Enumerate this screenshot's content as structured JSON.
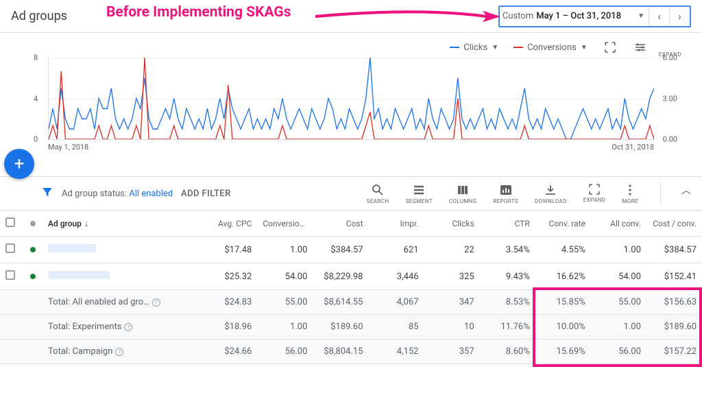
{
  "annotation": {
    "title": "Before Implementing SKAGs"
  },
  "header": {
    "title": "Ad groups",
    "date_picker": {
      "custom_label": "Custom",
      "range": "May 1 – Oct 31, 2018"
    }
  },
  "metrics": {
    "primary": {
      "label": "Clicks",
      "color": "#1a73e8"
    },
    "secondary": {
      "label": "Conversions",
      "color": "#d93025"
    },
    "expand_label": "EXPAND"
  },
  "chart_data": {
    "type": "line",
    "x_start_label": "May 1, 2018",
    "x_end_label": "Oct 31, 2018",
    "left_axis": {
      "label": "",
      "max": 8,
      "ticks": [
        0,
        4,
        8
      ]
    },
    "right_axis": {
      "label": "",
      "max": 6.0,
      "ticks": [
        0.0,
        3.0,
        6.0
      ]
    },
    "series": [
      {
        "name": "Clicks",
        "color": "#1a73e8",
        "axis": "left",
        "values": [
          1,
          3,
          1,
          5,
          2,
          1,
          1,
          3,
          2,
          2,
          3,
          1,
          4,
          3,
          3,
          5,
          2,
          1,
          2,
          1,
          2,
          4,
          3,
          6,
          2,
          1,
          1,
          2,
          3,
          2,
          4,
          2,
          1,
          3,
          2,
          1,
          2,
          1,
          3,
          1,
          2,
          4,
          2,
          5,
          3,
          2,
          1,
          2,
          3,
          1,
          2,
          1,
          2,
          1,
          3,
          2,
          4,
          2,
          1,
          2,
          3,
          2,
          1,
          3,
          2,
          1,
          2,
          4,
          3,
          1,
          2,
          1,
          3,
          2,
          1,
          2,
          4,
          8,
          2,
          3,
          1,
          2,
          1,
          3,
          2,
          1,
          2,
          3,
          1,
          2,
          1,
          4,
          2,
          1,
          3,
          2,
          1,
          2,
          6,
          2,
          1,
          2,
          1,
          2,
          3,
          1,
          2,
          1,
          3,
          2,
          1,
          2,
          1,
          3,
          5,
          2,
          1,
          2,
          1,
          3,
          2,
          1,
          2,
          1,
          0,
          0,
          1,
          2,
          3,
          2,
          1,
          2,
          1,
          2,
          3,
          1,
          2,
          1,
          4,
          2,
          1,
          2,
          3,
          2,
          4,
          5
        ]
      },
      {
        "name": "Conversions",
        "color": "#d93025",
        "axis": "right",
        "values": [
          0,
          1,
          0,
          5,
          0,
          0,
          0,
          0,
          0,
          0,
          0,
          0,
          1,
          0,
          0,
          1,
          0,
          0,
          0,
          0,
          0,
          1,
          0,
          6,
          0,
          0,
          0,
          0,
          0,
          0,
          1,
          0,
          0,
          0,
          0,
          0,
          0,
          0,
          0,
          0,
          0,
          1,
          0,
          4,
          0,
          0,
          0,
          0,
          0,
          0,
          0,
          0,
          0,
          0,
          0,
          0,
          1,
          0,
          0,
          0,
          0,
          0,
          0,
          0,
          0,
          0,
          0,
          0,
          0,
          0,
          0,
          0,
          0,
          0,
          0,
          0,
          1,
          2,
          0,
          0,
          0,
          0,
          0,
          0,
          0,
          0,
          0,
          0,
          0,
          0,
          0,
          1,
          0,
          0,
          0,
          0,
          0,
          0,
          3,
          0,
          0,
          0,
          0,
          0,
          0,
          0,
          0,
          0,
          0,
          0,
          0,
          0,
          0,
          0,
          1,
          0,
          0,
          0,
          0,
          0,
          0,
          0,
          0,
          0,
          0,
          0,
          0,
          0,
          0,
          0,
          0,
          0,
          0,
          0,
          0,
          0,
          0,
          0,
          1,
          0,
          0,
          0,
          0,
          0,
          1,
          0
        ]
      }
    ]
  },
  "filter_bar": {
    "status_prefix": "Ad group status: ",
    "status_value": "All enabled",
    "add_filter": "ADD FILTER"
  },
  "toolbar_icons": {
    "search": "SEARCH",
    "segment": "SEGMENT",
    "columns": "COLUMNS",
    "reports": "REPORTS",
    "download": "DOWNLOAD",
    "expand": "EXPAND",
    "more": "MORE"
  },
  "table": {
    "columns": [
      "Ad group",
      "Avg. CPC",
      "Conversions",
      "Cost",
      "Impr.",
      "Clicks",
      "CTR",
      "Conv. rate",
      "All conv.",
      "Cost / conv."
    ],
    "sort_col": "Ad group",
    "rows": [
      {
        "status": "enabled",
        "name_redacted_width": 70,
        "cells": [
          "$17.48",
          "1.00",
          "$384.57",
          "621",
          "22",
          "3.54%",
          "4.55%",
          "1.00",
          "$384.57"
        ]
      },
      {
        "status": "enabled",
        "name_redacted_width": 90,
        "cells": [
          "$25.32",
          "54.00",
          "$8,229.98",
          "3,446",
          "325",
          "9.43%",
          "16.62%",
          "54.00",
          "$152.41"
        ]
      }
    ],
    "totals": [
      {
        "label": "Total: All enabled ad gro…",
        "help": true,
        "cells": [
          "$24.83",
          "55.00",
          "$8,614.55",
          "4,067",
          "347",
          "8.53%",
          "15.85%",
          "55.00",
          "$156.63"
        ]
      },
      {
        "label": "Total: Experiments",
        "help": true,
        "cells": [
          "$18.96",
          "1.00",
          "$189.60",
          "85",
          "10",
          "11.76%",
          "10.00%",
          "1.00",
          "$189.60"
        ]
      },
      {
        "label": "Total: Campaign",
        "help": true,
        "cells": [
          "$24.66",
          "56.00",
          "$8,804.15",
          "4,152",
          "357",
          "8.60%",
          "15.69%",
          "56.00",
          "$157.22"
        ]
      }
    ]
  }
}
